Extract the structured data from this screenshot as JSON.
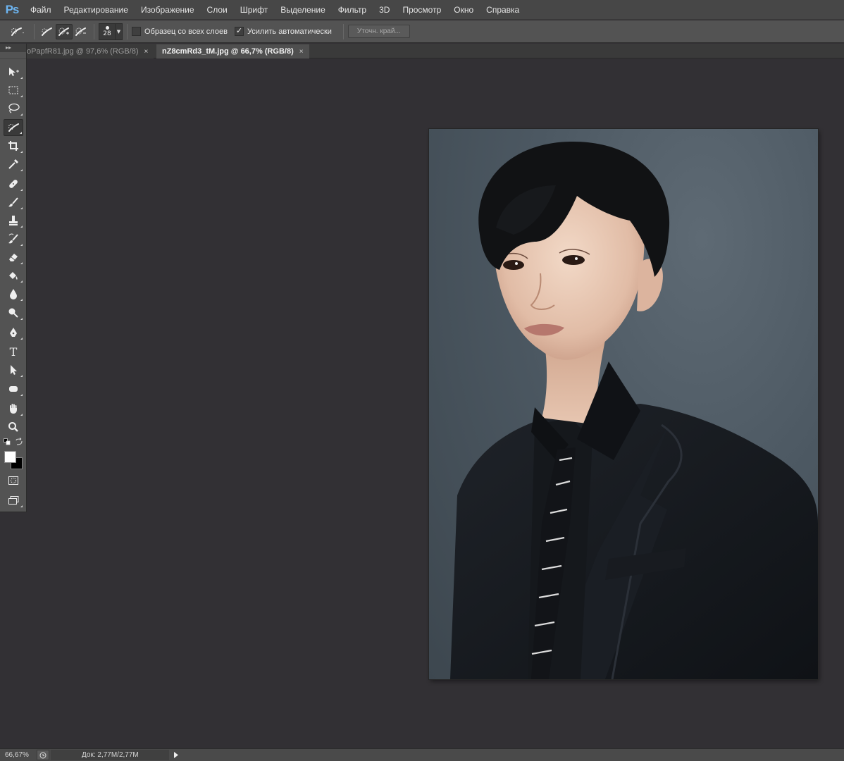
{
  "app": {
    "logo": "Ps"
  },
  "menu": [
    "Файл",
    "Редактирование",
    "Изображение",
    "Слои",
    "Шрифт",
    "Выделение",
    "Фильтр",
    "3D",
    "Просмотр",
    "Окно",
    "Справка"
  ],
  "options": {
    "brush_size": "28",
    "sample_all_layers_label": "Образец со всех слоев",
    "sample_all_layers_checked": false,
    "auto_enhance_label": "Усилить автоматически",
    "auto_enhance_checked": true,
    "refine_edge_label": "Уточн. край..."
  },
  "tabs": [
    {
      "label": "oPapfR81.jpg @ 97,6% (RGB/8)",
      "active": false
    },
    {
      "label": "nZ8cmRd3_tM.jpg @ 66,7% (RGB/8)",
      "active": true
    }
  ],
  "tab_close_glyph": "×",
  "tools": {
    "header": "▸▸",
    "items": [
      "move-tool",
      "marquee-tool",
      "lasso-tool",
      "quick-selection-tool",
      "crop-tool",
      "eyedropper-tool",
      "healing-brush-tool",
      "brush-tool",
      "clone-stamp-tool",
      "history-brush-tool",
      "eraser-tool",
      "paint-bucket-tool",
      "blur-tool",
      "dodge-tool",
      "pen-tool",
      "type-tool",
      "path-selection-tool",
      "shape-tool",
      "hand-tool",
      "zoom-tool"
    ],
    "active": "quick-selection-tool",
    "type_glyph": "T",
    "foreground_color": "#ffffff",
    "background_color": "#000000"
  },
  "status": {
    "zoom": "66,67%",
    "doc_info": "Док: 2,77M/2,77M"
  }
}
